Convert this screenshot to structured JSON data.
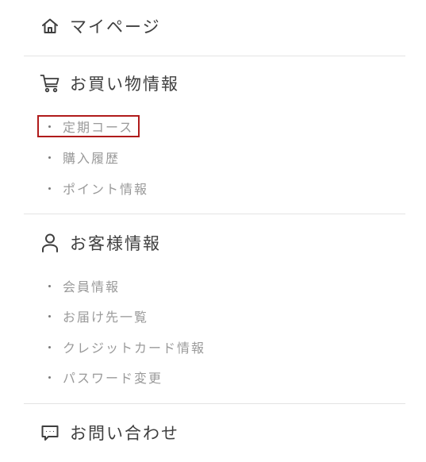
{
  "menu": {
    "mypage": {
      "label": "マイページ",
      "icon": "home-icon"
    },
    "shopping": {
      "label": "お買い物情報",
      "icon": "cart-icon",
      "items": [
        {
          "label": "定期コース"
        },
        {
          "label": "購入履歴"
        },
        {
          "label": "ポイント情報"
        }
      ]
    },
    "customer": {
      "label": "お客様情報",
      "icon": "user-icon",
      "items": [
        {
          "label": "会員情報"
        },
        {
          "label": "お届け先一覧"
        },
        {
          "label": "クレジットカード情報"
        },
        {
          "label": "パスワード変更"
        }
      ]
    },
    "contact": {
      "label": "お問い合わせ",
      "icon": "chat-icon"
    }
  },
  "colors": {
    "highlight_border": "#b01b1b",
    "divider": "#e3e3e3",
    "heading_text": "#3f3f3f",
    "sub_text": "#9a9a9a"
  }
}
